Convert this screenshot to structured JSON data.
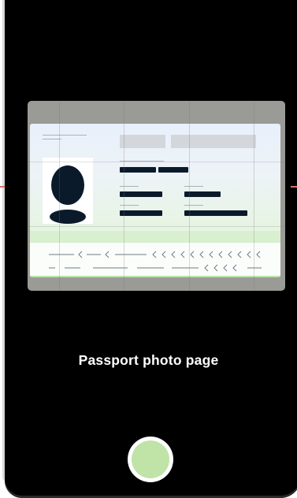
{
  "screen": {
    "caption": "Passport photo page"
  },
  "shutter": {
    "icon": "shutter-button-icon",
    "fill_color": "#c0e3a8"
  },
  "document_illustration": {
    "type": "passport-data-page",
    "portrait_icon": "person-silhouette-icon",
    "colors": {
      "text_bars": "#0b1a2b",
      "card_top": "#e8f0fb",
      "card_bottom": "#e4f7dd",
      "frame": "#9a9a96"
    }
  },
  "guides": {
    "color": "#e0706c"
  }
}
